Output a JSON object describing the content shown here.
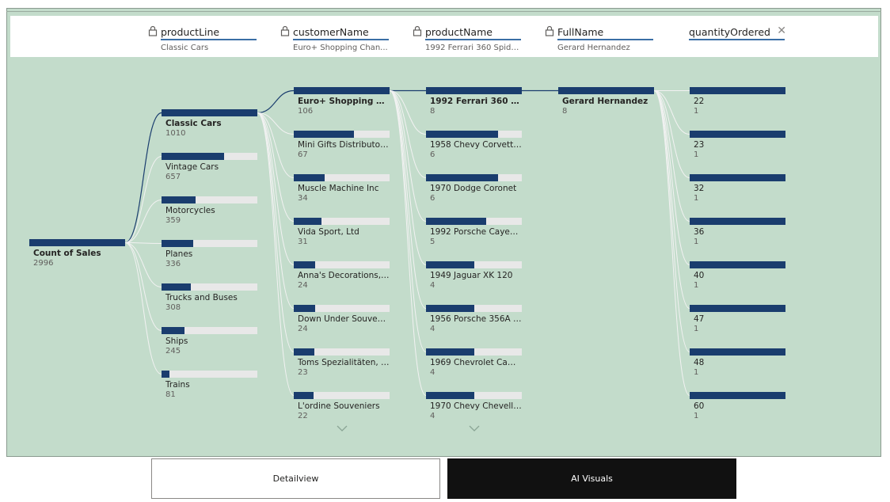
{
  "colors": {
    "panel_bg": "#c3dccb",
    "bar_fill": "#1a3d6e",
    "bar_track": "#e8e8e8",
    "connector": "#1a3d6e"
  },
  "header": {
    "levels": [
      {
        "title": "productLine",
        "selected": "Classic Cars",
        "icon": "lock-icon"
      },
      {
        "title": "customerName",
        "selected": "Euro+ Shopping Chan...",
        "icon": "lock-icon"
      },
      {
        "title": "productName",
        "selected": "1992 Ferrari 360 Spide...",
        "icon": "lock-icon"
      },
      {
        "title": "FullName",
        "selected": "Gerard Hernandez",
        "icon": "lock-icon"
      },
      {
        "title": "quantityOrdered",
        "selected": "",
        "icon": "close-icon"
      }
    ]
  },
  "tree": {
    "root": {
      "label": "Count of Sales",
      "value": 2996
    },
    "columns": [
      {
        "max": 1010,
        "nodes": [
          {
            "label": "Classic Cars",
            "value": 1010,
            "selected": true
          },
          {
            "label": "Vintage Cars",
            "value": 657
          },
          {
            "label": "Motorcycles",
            "value": 359
          },
          {
            "label": "Planes",
            "value": 336
          },
          {
            "label": "Trucks and Buses",
            "value": 308
          },
          {
            "label": "Ships",
            "value": 245
          },
          {
            "label": "Trains",
            "value": 81
          }
        ]
      },
      {
        "max": 106,
        "more": true,
        "nodes": [
          {
            "label": "Euro+ Shopping Cha...",
            "value": 106,
            "selected": true
          },
          {
            "label": "Mini Gifts Distributors ...",
            "value": 67
          },
          {
            "label": "Muscle Machine Inc",
            "value": 34
          },
          {
            "label": "Vida Sport, Ltd",
            "value": 31
          },
          {
            "label": "Anna's Decorations, Ltd",
            "value": 24
          },
          {
            "label": "Down Under Souvenie...",
            "value": 24
          },
          {
            "label": "Toms Spezialitäten, Ltd",
            "value": 23
          },
          {
            "label": "L'ordine Souveniers",
            "value": 22
          }
        ]
      },
      {
        "max": 8,
        "more": true,
        "nodes": [
          {
            "label": "1992 Ferrari 360 Spi...",
            "value": 8,
            "selected": true
          },
          {
            "label": "1958 Chevy Corvette L...",
            "value": 6
          },
          {
            "label": "1970 Dodge Coronet",
            "value": 6
          },
          {
            "label": "1992 Porsche Cayenne...",
            "value": 5
          },
          {
            "label": "1949 Jaguar XK 120",
            "value": 4
          },
          {
            "label": "1956 Porsche 356A Co...",
            "value": 4
          },
          {
            "label": "1969 Chevrolet Camar...",
            "value": 4
          },
          {
            "label": "1970 Chevy Chevelle S...",
            "value": 4
          }
        ]
      },
      {
        "max": 8,
        "nodes": [
          {
            "label": "Gerard Hernandez",
            "value": 8,
            "selected": true
          }
        ]
      },
      {
        "max": 1,
        "nodes": [
          {
            "label": "22",
            "value": 1
          },
          {
            "label": "23",
            "value": 1
          },
          {
            "label": "32",
            "value": 1
          },
          {
            "label": "36",
            "value": 1
          },
          {
            "label": "40",
            "value": 1
          },
          {
            "label": "47",
            "value": 1
          },
          {
            "label": "48",
            "value": 1
          },
          {
            "label": "60",
            "value": 1
          }
        ]
      }
    ]
  },
  "tabs": [
    {
      "label": "Detailview",
      "active": false
    },
    {
      "label": "AI Visuals",
      "active": true
    }
  ]
}
